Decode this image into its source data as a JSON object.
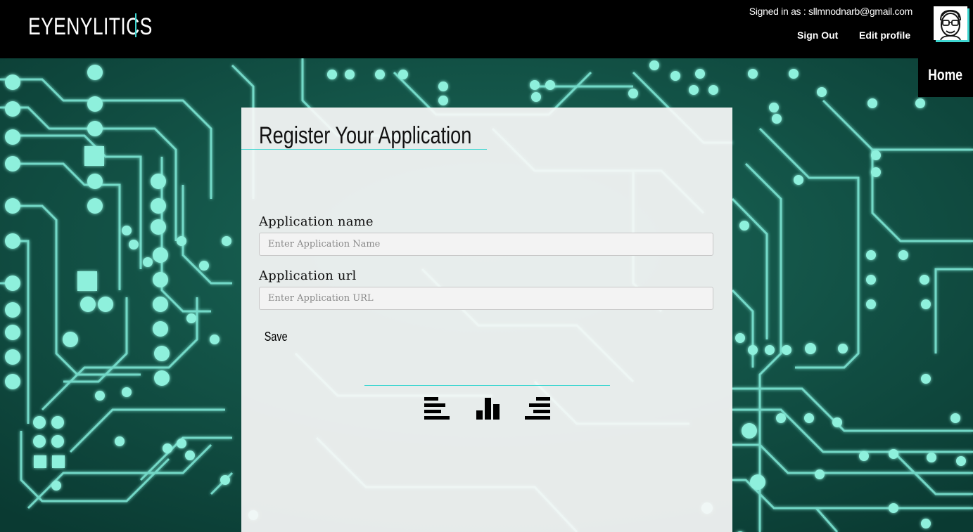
{
  "header": {
    "brand": "EYENYLITICS",
    "signed_in_text": "Signed in as : sllmnodnarb@gmail.com",
    "sign_out_label": "Sign Out",
    "edit_profile_label": "Edit profile"
  },
  "nav": {
    "home_label": "Home"
  },
  "form": {
    "title": "Register Your Application",
    "name_label": "Application name",
    "name_placeholder": "Enter Application Name",
    "name_value": "",
    "url_label": "Application url",
    "url_placeholder": "Enter Application URL",
    "url_value": "",
    "save_label": "Save"
  },
  "icons": {
    "align_left": "align-left-icon",
    "bar_chart": "bar-chart-icon",
    "align_right": "align-right-icon"
  },
  "colors": {
    "accent": "#3ed6d1",
    "header_bg": "#000000",
    "circuit_bg": "#0d3f36",
    "circuit_trace": "#7ee8d6"
  }
}
